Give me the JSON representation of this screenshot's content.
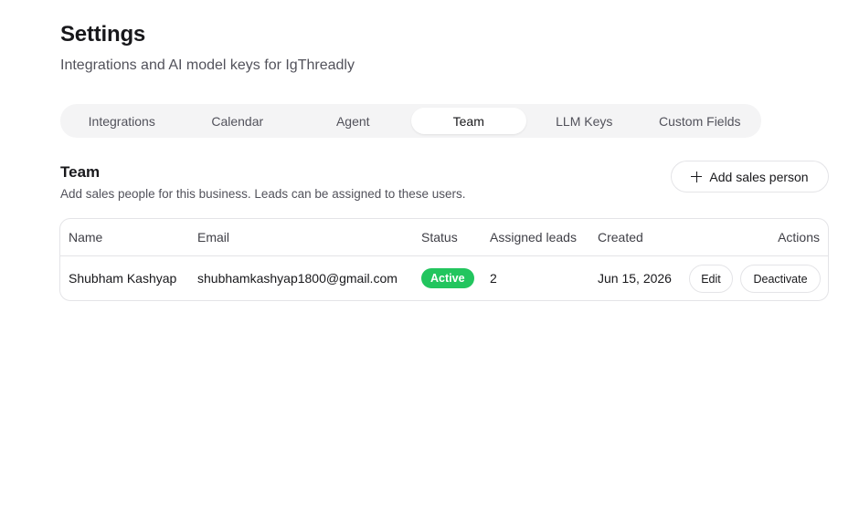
{
  "header": {
    "title": "Settings",
    "subtitle": "Integrations and AI model keys for IgThreadly"
  },
  "tabs": [
    {
      "label": "Integrations",
      "active": false
    },
    {
      "label": "Calendar",
      "active": false
    },
    {
      "label": "Agent",
      "active": false
    },
    {
      "label": "Team",
      "active": true
    },
    {
      "label": "LLM Keys",
      "active": false
    },
    {
      "label": "Custom Fields",
      "active": false
    }
  ],
  "team": {
    "title": "Team",
    "description": "Add sales people for this business. Leads can be assigned to these users.",
    "add_button_label": "Add sales person",
    "add_button_icon": "plus-icon",
    "columns": {
      "name": "Name",
      "email": "Email",
      "status": "Status",
      "assigned_leads": "Assigned leads",
      "created": "Created",
      "actions": "Actions"
    },
    "rows": [
      {
        "name": "Shubham Kashyap",
        "email": "shubhamkashyap1800@gmail.com",
        "status": "Active",
        "assigned_leads": "2",
        "created": "Jun 15, 2026",
        "edit_label": "Edit",
        "deactivate_label": "Deactivate"
      }
    ]
  },
  "colors": {
    "status_active": "#22c55e",
    "tab_track": "#f4f4f5",
    "border": "#e4e4e7"
  }
}
